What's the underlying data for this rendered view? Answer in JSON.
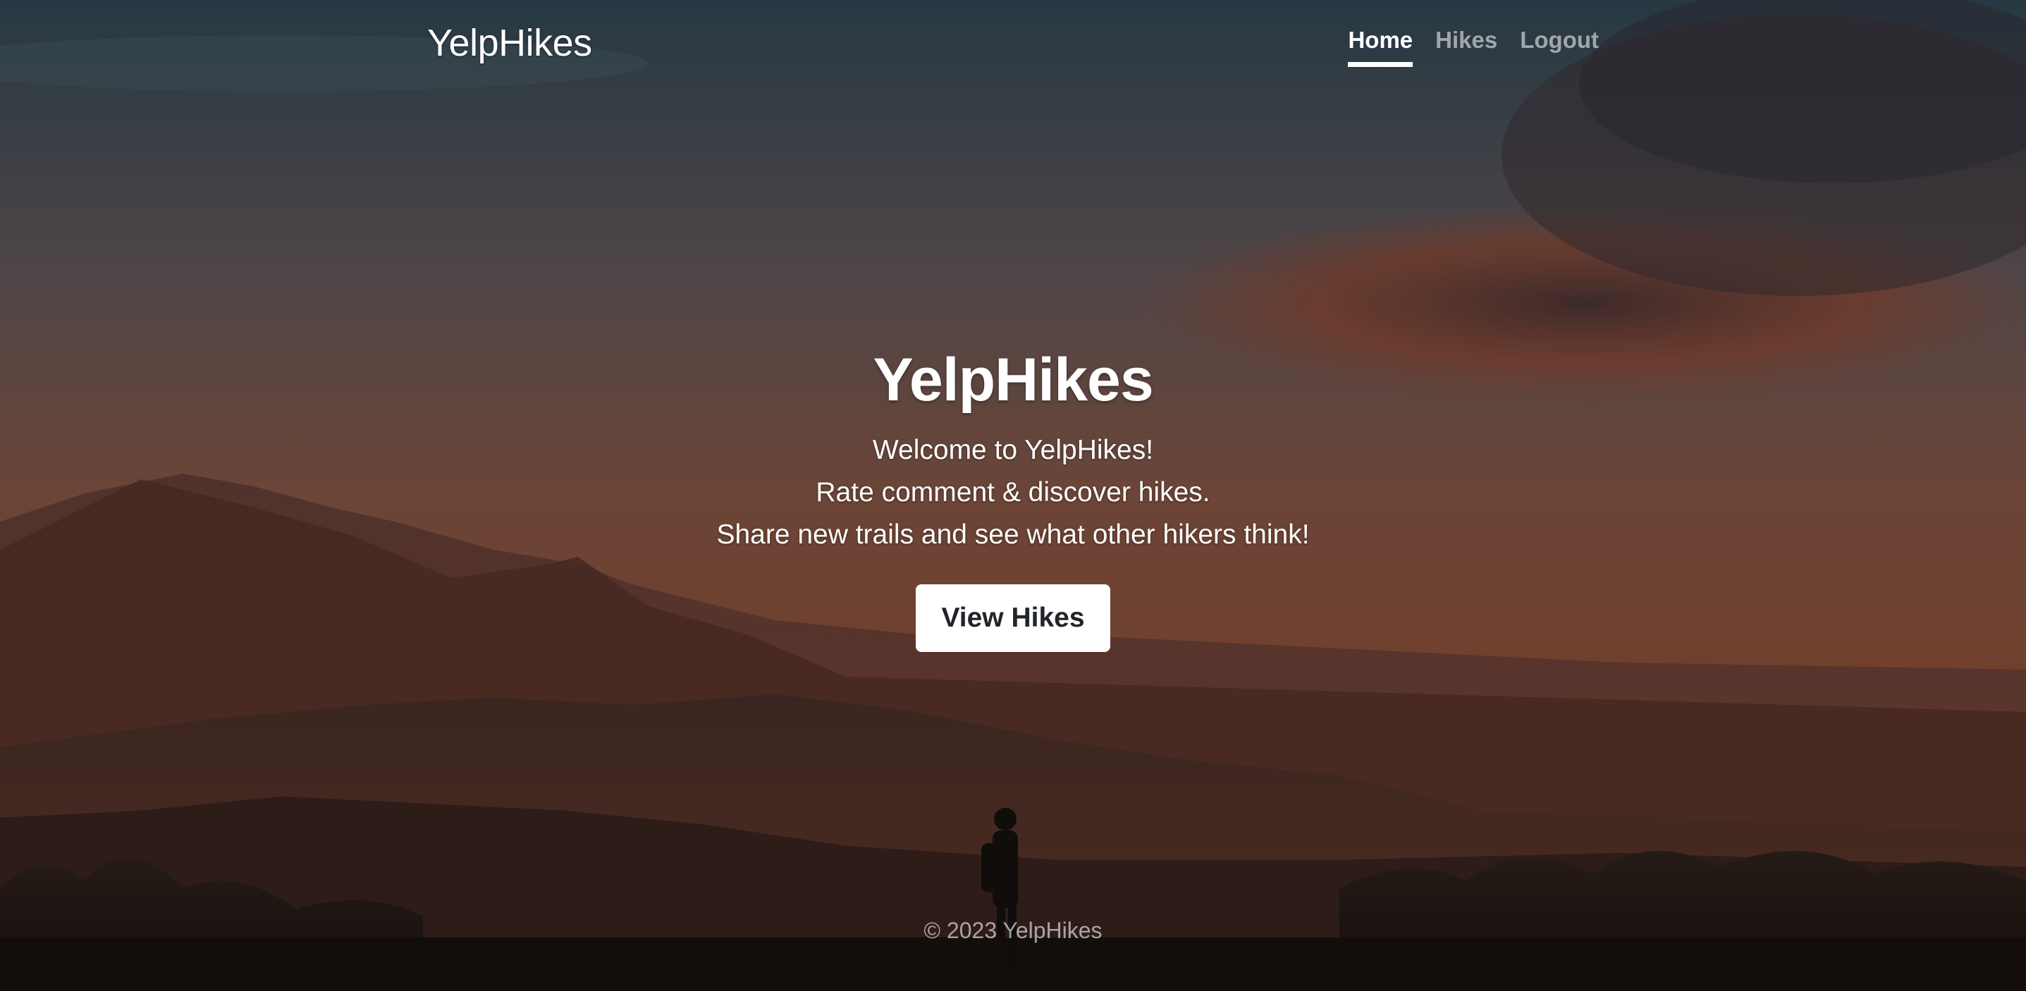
{
  "header": {
    "brand": "YelpHikes",
    "nav": [
      {
        "label": "Home",
        "active": true
      },
      {
        "label": "Hikes",
        "active": false
      },
      {
        "label": "Logout",
        "active": false
      }
    ]
  },
  "hero": {
    "title": "YelpHikes",
    "lines": [
      "Welcome to YelpHikes!",
      "Rate comment & discover hikes.",
      "Share new trails and see what other hikers think!"
    ],
    "button_label": "View Hikes"
  },
  "footer": {
    "text": "© 2023 YelpHikes"
  },
  "colors": {
    "sky_top": "#3f5968",
    "sky_mid": "#8a6660",
    "horizon": "#b5684c",
    "mountains_far": "#7a4a40",
    "mountains_near": "#3a2a24",
    "button_bg": "#ffffff",
    "button_text": "#212529"
  }
}
